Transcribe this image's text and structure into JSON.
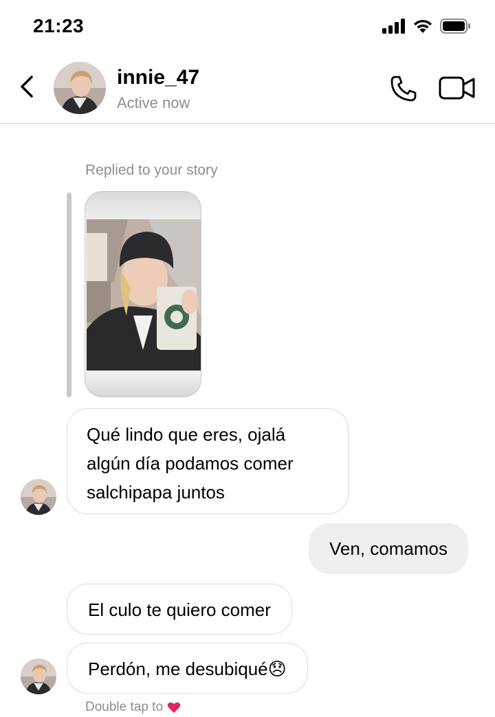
{
  "status_bar": {
    "time": "21:23",
    "icons": [
      "signal-icon",
      "wifi-icon",
      "battery-icon"
    ]
  },
  "header": {
    "username": "innie_47",
    "status": "Active now",
    "icons": [
      "back-icon",
      "phone-icon",
      "video-icon"
    ]
  },
  "conversation": {
    "story_reply_label": "Replied to your story",
    "messages": [
      {
        "from": "them",
        "text": "Qué lindo que eres, ojalá algún día podamos comer salchipapa juntos"
      },
      {
        "from": "me",
        "text": "Ven, comamos"
      },
      {
        "from": "them",
        "text": "El culo te quiero comer"
      },
      {
        "from": "them",
        "text": "Perdón, me desubiqué😞"
      }
    ],
    "hint_text": "Double tap to",
    "hint_emoji": "❤️"
  },
  "colors": {
    "secondary_text": "#8e8e8e",
    "incoming_border": "#dbdbdb",
    "outgoing_bg": "#efefef",
    "heart": "#e0245e"
  }
}
